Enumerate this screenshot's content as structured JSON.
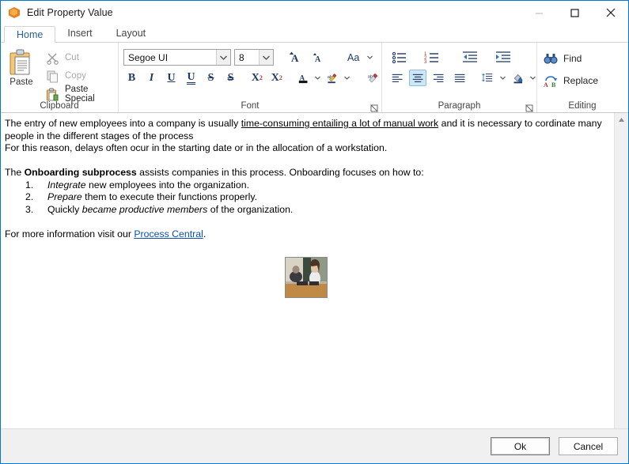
{
  "window": {
    "title": "Edit Property Value",
    "icon": "app-hexagon-icon",
    "minimize_label": "—",
    "maximize_label": "□",
    "close_label": "✕"
  },
  "tabs": [
    {
      "label": "Home",
      "active": true
    },
    {
      "label": "Insert",
      "active": false
    },
    {
      "label": "Layout",
      "active": false
    }
  ],
  "ribbon": {
    "clipboard": {
      "group_label": "Clipboard",
      "paste_label": "Paste",
      "items": [
        {
          "label": "Cut",
          "icon": "scissors-icon",
          "enabled": false
        },
        {
          "label": "Copy",
          "icon": "copy-icon",
          "enabled": false
        },
        {
          "label": "Paste Special",
          "icon": "paste-special-icon",
          "enabled": true
        }
      ]
    },
    "font": {
      "group_label": "Font",
      "font_family_value": "Segoe UI",
      "font_size_value": "8",
      "grow_font_label": "A",
      "shrink_font_label": "A",
      "change_case_label": "Aa",
      "buttons": [
        {
          "label": "B",
          "name": "bold-button"
        },
        {
          "label": "I",
          "name": "italic-button"
        },
        {
          "label": "U",
          "name": "underline-button"
        },
        {
          "label": "U",
          "name": "double-underline-button"
        },
        {
          "label": "S",
          "name": "strikethrough-button"
        },
        {
          "label": "S",
          "name": "double-strikethrough-button"
        },
        {
          "label": "X",
          "name": "superscript-button",
          "sup": "2"
        },
        {
          "label": "X",
          "name": "subscript-button",
          "sub": "2"
        }
      ],
      "font_color_label": "A",
      "highlight_label": "ab",
      "clear_formatting_label": "ab"
    },
    "paragraph": {
      "group_label": "Paragraph",
      "bullets_label": "Bullets",
      "numbering_label": "Numbering",
      "decrease_indent_label": "Decrease Indent",
      "increase_indent_label": "Increase Indent",
      "align_left_label": "Align Left",
      "align_center_label": "Center",
      "align_right_label": "Align Right",
      "justify_label": "Justify",
      "line_spacing_label": "Line Spacing",
      "shading_label": "Shading",
      "active_alignment": "center"
    },
    "editing": {
      "group_label": "Editing",
      "find_label": "Find",
      "replace_label": "Replace"
    }
  },
  "document": {
    "para1_a": "The entry of new employees into a company is usually ",
    "para1_underlined": "time-consuming entailing a lot of manual work",
    "para1_b": " and it is necessary to cordinate many people in the different stages of the process",
    "para2": "For this reason, delays often ocur in the starting date or in the allocation of a workstation.",
    "para3_a": "The ",
    "para3_bold": "Onboarding subprocess",
    "para3_b": " assists companies in this process. Onboarding focuses on how to:",
    "list": [
      {
        "num": "1.",
        "italic_lead": "Integrate",
        "rest": " new employees into the organization.",
        "plain_lead": ""
      },
      {
        "num": "2.",
        "italic_lead": "Prepare",
        "rest": " them to execute their functions properly.",
        "plain_lead": ""
      },
      {
        "num": "3.",
        "italic_lead": "became productive members",
        "rest": " of the organization.",
        "plain_lead": "Quickly "
      }
    ],
    "para4_a": "For more information visit our ",
    "para4_link": "Process Central",
    "para4_b": ".",
    "image_alt": "interview-photo"
  },
  "footer": {
    "ok_label": "Ok",
    "cancel_label": "Cancel"
  },
  "colors": {
    "accent": "#0078d7",
    "tab_active_text": "#2a6099",
    "link": "#0a4fb0",
    "toggle_on": "#cde6f7"
  }
}
